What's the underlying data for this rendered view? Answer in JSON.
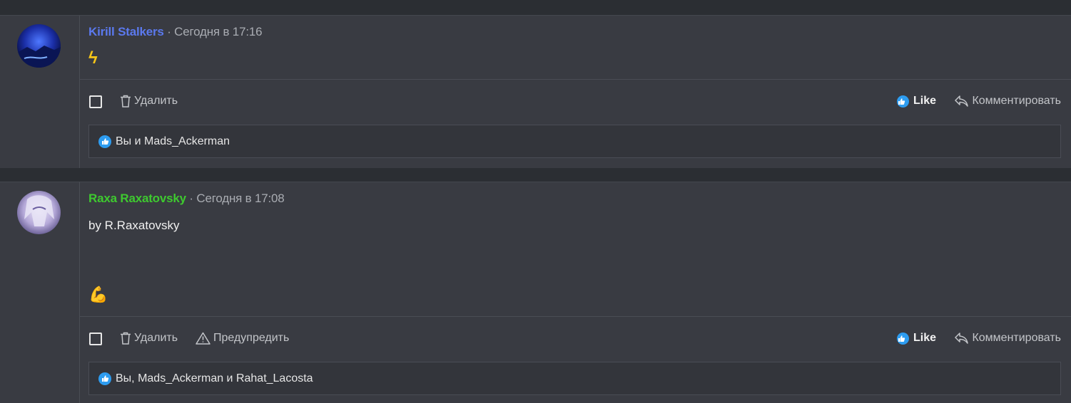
{
  "colors": {
    "author1": "#5b79ee",
    "author2": "#3ec92f",
    "like_icon": "#2d9cf0"
  },
  "posts": [
    {
      "author": "Kirill Stalkers",
      "meta": " · Сегодня в 17:16",
      "lines": [
        "ϟ"
      ],
      "delete_label": "Удалить",
      "like_label": "Like",
      "comment_label": "Комментировать",
      "likes_text": "Вы и Mads_Ackerman"
    },
    {
      "author": "Raxa Raxatovsky",
      "meta": " · Сегодня в 17:08",
      "lines": [
        "by R.Raxatovsky",
        "💪"
      ],
      "delete_label": "Удалить",
      "warn_label": "Предупредить",
      "like_label": "Like",
      "comment_label": "Комментировать",
      "likes_text": "Вы, Mads_Ackerman и Rahat_Lacosta"
    }
  ]
}
